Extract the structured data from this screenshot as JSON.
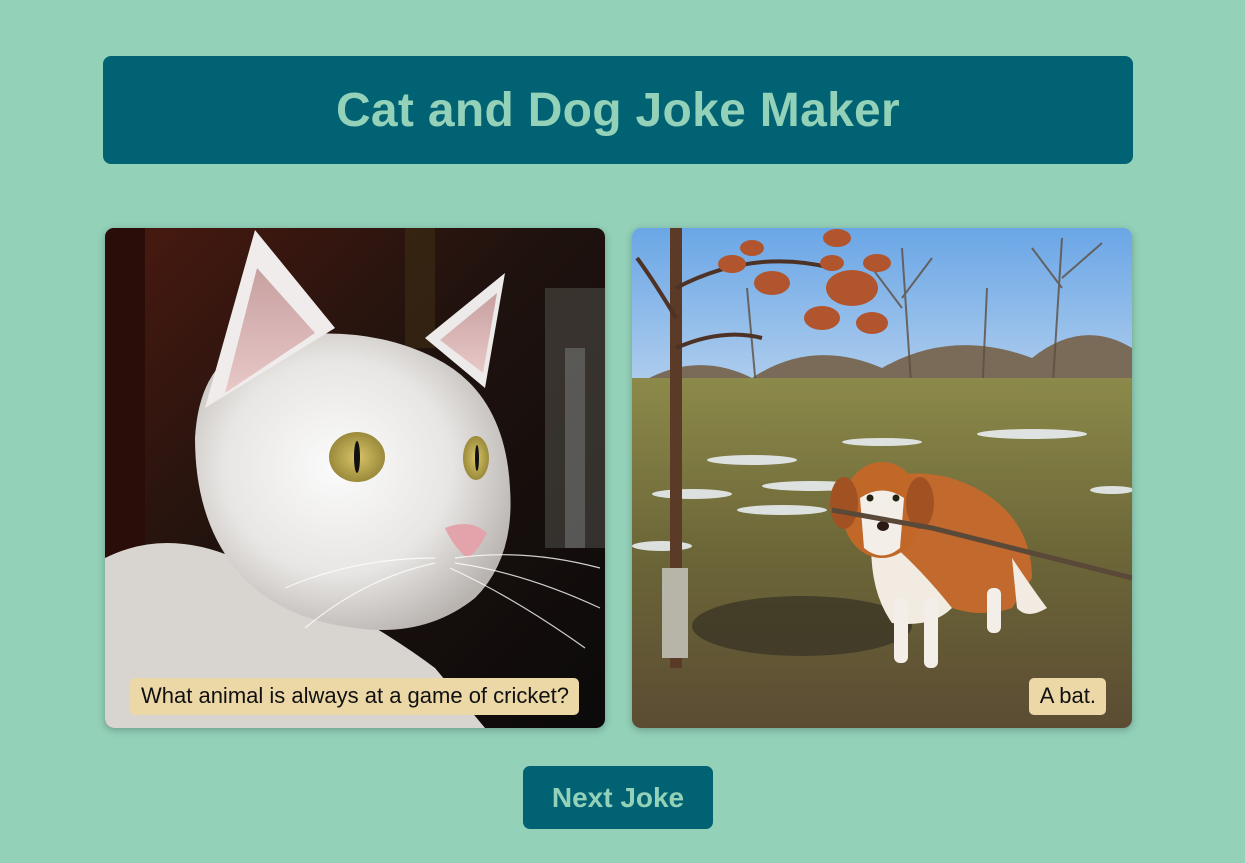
{
  "header": {
    "title": "Cat and Dog Joke Maker"
  },
  "jokes": {
    "question": "What animal is always at a game of cricket?",
    "answer": "A bat."
  },
  "controls": {
    "next_label": "Next Joke"
  },
  "images": {
    "left": "white-cat-photo",
    "right": "dog-with-stick-photo"
  },
  "colors": {
    "background": "#93d1b9",
    "header_bg": "#006272",
    "header_text": "#93d1b9",
    "caption_bg": "#ecd7a7"
  }
}
